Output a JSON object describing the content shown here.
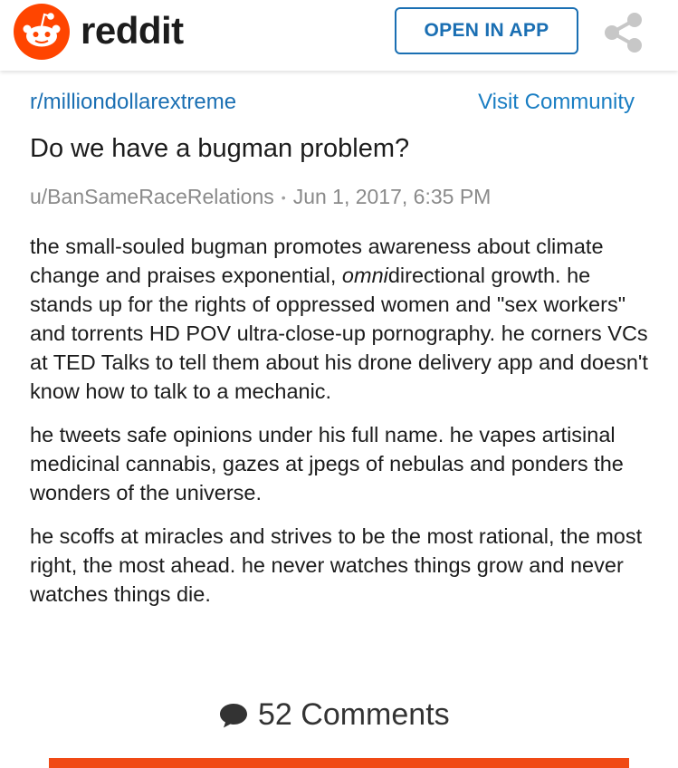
{
  "header": {
    "brand": "reddit",
    "open_in_app_label": "OPEN IN APP",
    "brand_color": "#ff4500",
    "accent_color": "#1a6fb3"
  },
  "post": {
    "subreddit": "r/milliondollarextreme",
    "visit_label": "Visit Community",
    "title": "Do we have a bugman problem?",
    "author": "u/BanSameRaceRelations",
    "separator": "•",
    "timestamp": "Jun 1, 2017, 6:35 PM",
    "paragraph1_before_italic": "the small-souled bugman promotes awareness about climate change and praises exponential, ",
    "paragraph1_italic": "omni",
    "paragraph1_after_italic": "directional growth. he stands up for the rights of oppressed women and \"sex workers\" and torrents HD POV ultra-close-up pornography. he corners VCs at TED Talks to tell them about his drone delivery app and doesn't know how to talk to a mechanic.",
    "paragraph2": "he tweets safe opinions under his full name. he vapes artisinal medicinal cannabis, gazes at jpegs of nebulas and ponders the wonders of the universe.",
    "paragraph3": "he scoffs at miracles and strives to be the most rational, the most right, the most ahead. he never watches things grow and never watches things die."
  },
  "footer": {
    "comments_label": "52 Comments",
    "icons": [
      "reddit-logo-icon",
      "share-icon",
      "comment-icon"
    ]
  }
}
